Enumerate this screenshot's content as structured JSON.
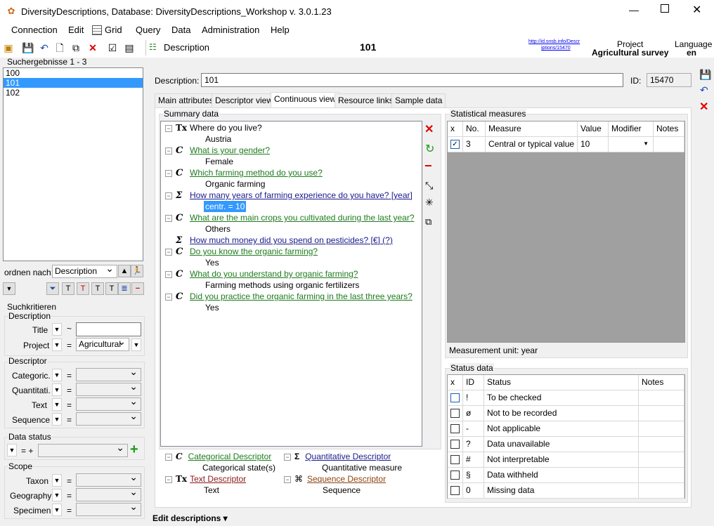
{
  "window": {
    "title": "DiversityDescriptions,  Database: DiversityDescriptions_Workshop    v. 3.0.1.23"
  },
  "menu": [
    "Connection",
    "Edit",
    "Grid",
    "Query",
    "Data",
    "Administration",
    "Help"
  ],
  "toolbar": {
    "description_label": "Description",
    "current_id": "101",
    "link_text_1": "http://id.snsb.info/Descr",
    "link_text_2": "iptions/15470",
    "project_label": "Project",
    "project_value": "Agricultural survey",
    "language_label": "Language",
    "language_value": "en"
  },
  "search": {
    "results_label": "Suchergebnisse   1 - 3",
    "results": [
      "100",
      "101",
      "102"
    ],
    "selected_index": 1,
    "order_label": "ordnen nach:",
    "order_value": "Description",
    "criteria_label": "Suchkritieren",
    "description_group": "Description",
    "title_label": "Title",
    "title_op": "~",
    "project_label": "Project",
    "project_op": "=",
    "project_value": "Agricultural",
    "descriptor_group": "Descriptor",
    "categoric_label": "Categoric.",
    "quantitati_label": "Quantitati.",
    "text_label": "Text",
    "sequence_label": "Sequence",
    "eq": "=",
    "data_status_group": "Data status",
    "data_status_ops": "=  +",
    "scope_group": "Scope",
    "taxon_label": "Taxon",
    "geography_label": "Geography",
    "specimen_label": "Specimen"
  },
  "main": {
    "description_label": "Description:",
    "description_value": "101",
    "id_label": "ID:",
    "id_value": "15470",
    "tabs": [
      "Main attributes",
      "Descriptor view",
      "Continuous view",
      "Resource links",
      "Sample data"
    ],
    "active_tab": 2,
    "summary_label": "Summary data",
    "tree": [
      {
        "type": "text",
        "q": "Where do you live?",
        "a": "Austria",
        "hl": false
      },
      {
        "type": "cat",
        "q": "What is your gender?",
        "a": "Female",
        "hl": false
      },
      {
        "type": "cat",
        "q": "Which farming method do you use?",
        "a": "Organic farming",
        "hl": false
      },
      {
        "type": "quan",
        "q": "How many years of farming experience do you have? [year]",
        "a": "centr. = 10",
        "hl": true
      },
      {
        "type": "cat",
        "q": "What are the main crops you cultivated during the last year?",
        "a": "Others",
        "hl": false
      },
      {
        "type": "quan",
        "q": "How much money did you spend on pesticides? [€] (?)",
        "a": "",
        "hl": false
      },
      {
        "type": "cat",
        "q": "Do you know the organic farming?",
        "a": "Yes",
        "hl": false
      },
      {
        "type": "cat",
        "q": "What do you understand by organic farming?",
        "a": "Farming methods using organic fertilizers",
        "hl": false
      },
      {
        "type": "cat",
        "q": "Did you practice the organic farming in the last three years?",
        "a": "Yes",
        "hl": false
      }
    ],
    "legend": {
      "cat_q": "Categorical Descriptor",
      "cat_a": "Categorical state(s)",
      "quan_q": "Quantitative Descriptor",
      "quan_a": "Quantitative measure",
      "text_q": "Text Descriptor",
      "text_a": "Text",
      "seq_q": "Sequence Descriptor",
      "seq_a": "Sequence"
    }
  },
  "stats": {
    "label": "Statistical measures",
    "headers": [
      "x",
      "No.",
      "Measure",
      "Value",
      "Modifier",
      "Notes"
    ],
    "rows": [
      {
        "x": true,
        "no": "3",
        "measure": "Central or typical value (...",
        "value": "10",
        "modifier": "",
        "notes": ""
      }
    ],
    "unit_label": "Measurement unit:  year"
  },
  "status": {
    "label": "Status data",
    "headers": [
      "x",
      "ID",
      "Status",
      "Notes"
    ],
    "rows": [
      {
        "id": "!",
        "status": "To be checked"
      },
      {
        "id": "ø",
        "status": "Not to be recorded"
      },
      {
        "id": "-",
        "status": "Not applicable"
      },
      {
        "id": "?",
        "status": "Data unavailable"
      },
      {
        "id": "#",
        "status": "Not interpretable"
      },
      {
        "id": "§",
        "status": "Data withheld"
      },
      {
        "id": "0",
        "status": "Missing data"
      }
    ]
  },
  "footer": {
    "label": "Edit descriptions ▾"
  },
  "colors": {
    "accent": "#3399ff",
    "cat": "#1e7b1e",
    "quan": "#1a1a8c",
    "text": "#8b1a1a",
    "seq": "#8b4513"
  }
}
